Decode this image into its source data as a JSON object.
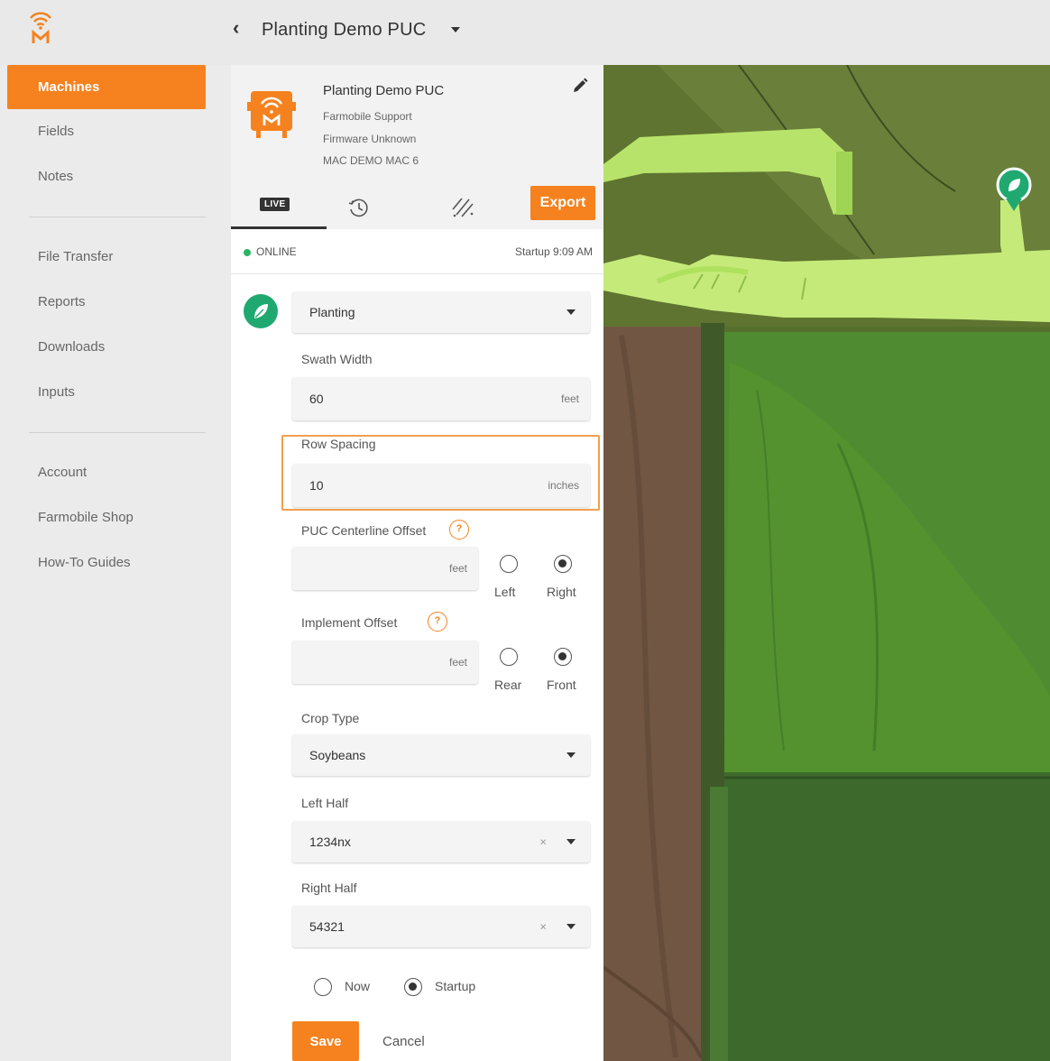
{
  "header": {
    "back_icon": "chevron-left-icon",
    "machine_title": "Planting Demo PUC"
  },
  "colors": {
    "accent": "#f5821f",
    "online": "#2ab464",
    "operation": "#1fa971",
    "coverage": "#c6ea7a"
  },
  "nav": {
    "items_top": [
      "Machines",
      "Fields",
      "Notes"
    ],
    "items_mid": [
      "File Transfer",
      "Reports",
      "Downloads",
      "Inputs"
    ],
    "items_bottom": [
      "Account",
      "Farmobile Shop",
      "How-To Guides"
    ],
    "active": "Machines"
  },
  "device": {
    "name": "Planting Demo PUC",
    "owner": "Farmobile Support",
    "firmware": "Firmware Unknown",
    "mac": "MAC DEMO MAC 6"
  },
  "tabs": {
    "live_label": "LIVE",
    "history_icon": "history-icon",
    "coverage_icon": "coverage-icon",
    "export_label": "Export"
  },
  "status": {
    "online_label": "ONLINE",
    "startup_label": "Startup 9:09 AM"
  },
  "form": {
    "operation": "Planting",
    "swath_width": {
      "label": "Swath Width",
      "value": "60",
      "unit": "feet"
    },
    "row_spacing": {
      "label": "Row Spacing",
      "value": "10",
      "unit": "inches"
    },
    "puc_offset": {
      "label": "PUC Centerline Offset",
      "value": "",
      "unit": "feet",
      "help": "?",
      "options": [
        "Left",
        "Right"
      ],
      "selected": "Right"
    },
    "implement_offset": {
      "label": "Implement Offset",
      "value": "",
      "unit": "feet",
      "help": "?",
      "options": [
        "Rear",
        "Front"
      ],
      "selected": "Front"
    },
    "crop_type": {
      "label": "Crop Type",
      "value": "Soybeans"
    },
    "left_half": {
      "label": "Left Half",
      "value": "1234nx",
      "clear": "×"
    },
    "right_half": {
      "label": "Right Half",
      "value": "54321",
      "clear": "×"
    },
    "apply_options": [
      "Now",
      "Startup"
    ],
    "apply_selected": "Startup",
    "save_label": "Save",
    "cancel_label": "Cancel"
  }
}
